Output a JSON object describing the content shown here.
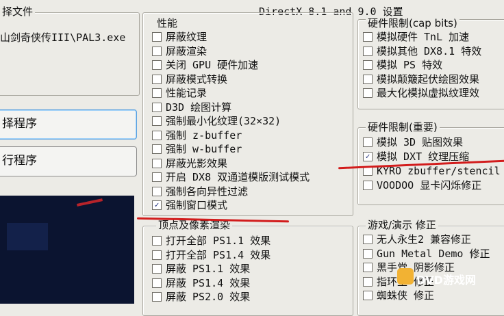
{
  "dialog": {
    "title": "DirectX 8.1 and 9.0 设置"
  },
  "left": {
    "file_group_title": "择文件",
    "file_path": "山剑奇侠传III\\PAL3.exe",
    "select_button": "择程序",
    "run_button": "行程序"
  },
  "performance": {
    "title": "性能",
    "items": [
      {
        "label": "屏蔽纹理",
        "checked": false
      },
      {
        "label": "屏蔽渲染",
        "checked": false
      },
      {
        "label": "关闭 GPU 硬件加速",
        "checked": false
      },
      {
        "label": "屏蔽模式转换",
        "checked": false
      },
      {
        "label": "性能记录",
        "checked": false
      },
      {
        "label": "D3D 绘图计算",
        "checked": false
      },
      {
        "label": "强制最小化纹理(32×32)",
        "checked": false
      },
      {
        "label": "强制 z-buffer",
        "checked": false
      },
      {
        "label": "强制 w-buffer",
        "checked": false
      },
      {
        "label": "屏蔽光影效果",
        "checked": false
      },
      {
        "label": "开启 DX8 双通道模版测试模式",
        "checked": false
      },
      {
        "label": "强制各向异性过滤",
        "checked": false
      },
      {
        "label": "强制窗口模式",
        "checked": true
      }
    ]
  },
  "vertex": {
    "title": "顶点及像素渲染",
    "items": [
      {
        "label": "打开全部 PS1.1 效果",
        "checked": false
      },
      {
        "label": "打开全部 PS1.4 效果",
        "checked": false
      },
      {
        "label": "屏蔽 PS1.1 效果",
        "checked": false
      },
      {
        "label": "屏蔽 PS1.4 效果",
        "checked": false
      },
      {
        "label": "屏蔽 PS2.0 效果",
        "checked": false
      }
    ]
  },
  "caps": {
    "title": "硬件限制(cap bits)",
    "items": [
      {
        "label": "模拟硬件 TnL 加速",
        "checked": false
      },
      {
        "label": "模拟其他 DX8.1 特效",
        "checked": false
      },
      {
        "label": "模拟 PS 特效",
        "checked": false
      },
      {
        "label": "模拟颠簸起伏绘图效果",
        "checked": false
      },
      {
        "label": "最大化模拟虚拟纹理效",
        "checked": false
      }
    ]
  },
  "important": {
    "title": "硬件限制(重要)",
    "items": [
      {
        "label": "模拟 3D 贴图效果",
        "checked": false
      },
      {
        "label": "模拟 DXT 纹理压缩",
        "checked": true
      },
      {
        "label": "KYRO zbuffer/stencil",
        "checked": false
      },
      {
        "label": "VOODOO 显卡闪烁修正",
        "checked": false
      }
    ]
  },
  "game": {
    "title": "游戏/演示 修正",
    "items": [
      {
        "label": "无人永生2 兼容修正",
        "checked": false
      },
      {
        "label": "Gun Metal Demo 修正",
        "checked": false
      },
      {
        "label": "黑手党 阴影修正",
        "checked": false
      },
      {
        "label": "指环王 修正",
        "checked": false
      },
      {
        "label": "蜘蛛侠 修正",
        "checked": false
      }
    ]
  },
  "watermark": "DVD游戏网",
  "accent_colors": {
    "annotation_red": "#d21c1c",
    "button_focus": "#5aa0e0"
  }
}
